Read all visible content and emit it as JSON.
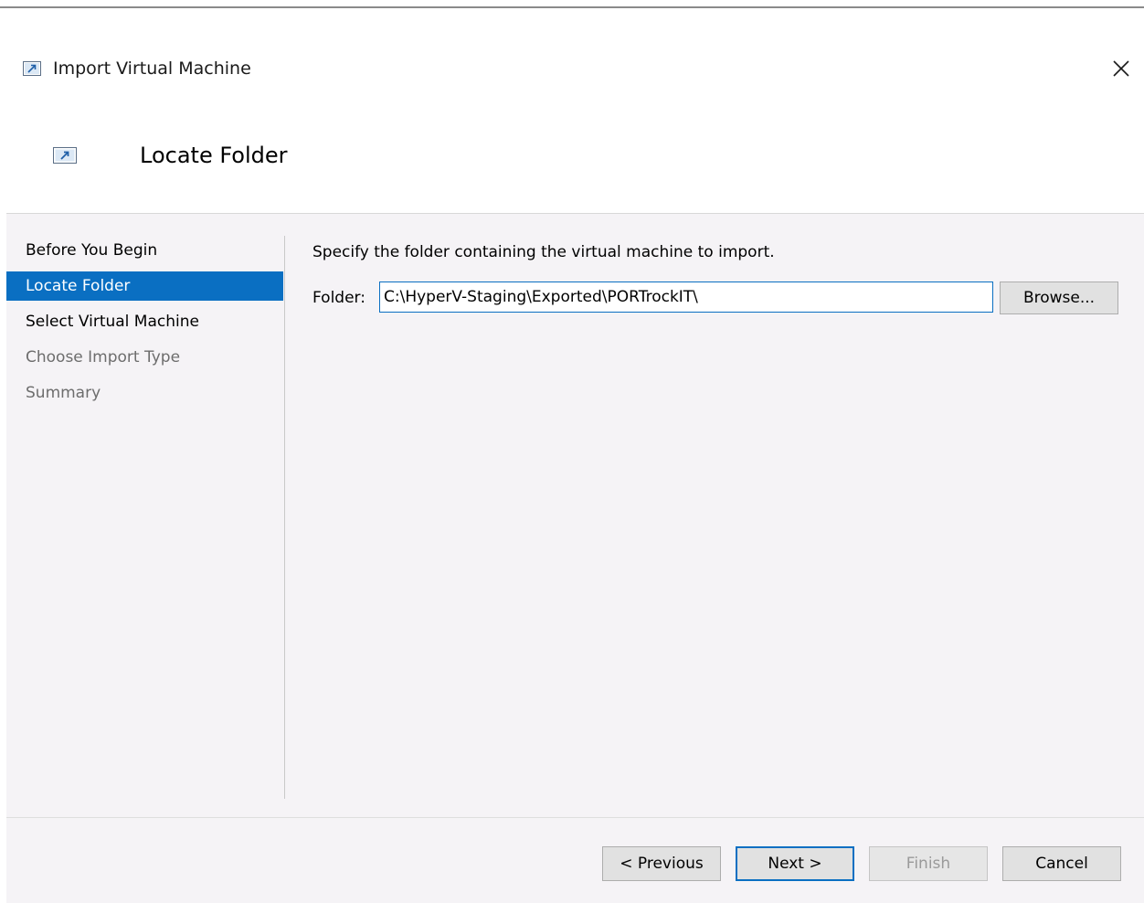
{
  "window": {
    "title": "Import Virtual Machine",
    "title_icon": "import-vm-icon",
    "close_icon": "close-icon"
  },
  "header": {
    "title": "Locate Folder",
    "icon": "import-vm-icon"
  },
  "nav": {
    "items": [
      {
        "label": "Before You Begin",
        "state": "normal"
      },
      {
        "label": "Locate Folder",
        "state": "selected"
      },
      {
        "label": "Select Virtual Machine",
        "state": "normal"
      },
      {
        "label": "Choose Import Type",
        "state": "disabled"
      },
      {
        "label": "Summary",
        "state": "disabled"
      }
    ]
  },
  "main": {
    "instruction": "Specify the folder containing the virtual machine to import.",
    "folder_label": "Folder:",
    "folder_value": "C:\\HyperV-Staging\\Exported\\PORTrockIT\\",
    "browse_label": "Browse..."
  },
  "footer": {
    "previous_label": "< Previous",
    "next_label": "Next >",
    "finish_label": "Finish",
    "cancel_label": "Cancel"
  },
  "colors": {
    "accent": "#0a6fc2",
    "body_background": "#f5f3f6",
    "disabled_text": "#6d6d6d"
  }
}
